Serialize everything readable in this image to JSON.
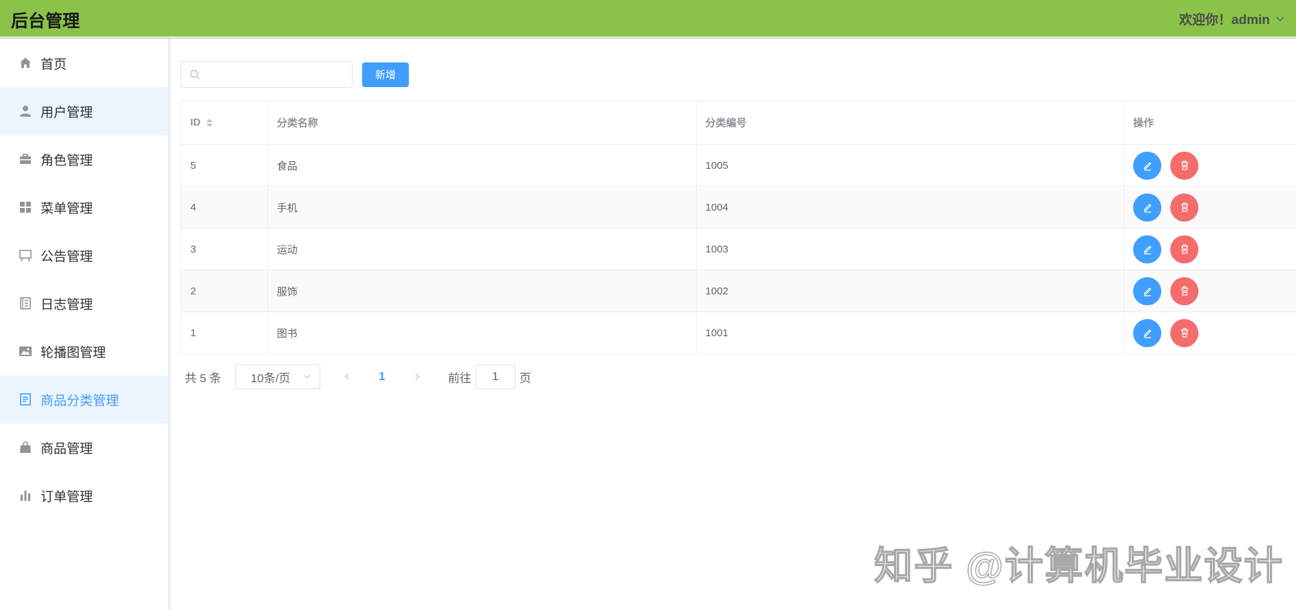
{
  "header": {
    "title": "后台管理",
    "welcome": "欢迎你！admin"
  },
  "sidebar": {
    "items": [
      {
        "label": "首页",
        "icon": "home-icon"
      },
      {
        "label": "用户管理",
        "icon": "user-icon"
      },
      {
        "label": "角色管理",
        "icon": "briefcase-icon"
      },
      {
        "label": "菜单管理",
        "icon": "grid-icon"
      },
      {
        "label": "公告管理",
        "icon": "board-icon"
      },
      {
        "label": "日志管理",
        "icon": "notebook-icon"
      },
      {
        "label": "轮播图管理",
        "icon": "picture-icon"
      },
      {
        "label": "商品分类管理",
        "icon": "document-icon"
      },
      {
        "label": "商品管理",
        "icon": "bag-icon"
      },
      {
        "label": "订单管理",
        "icon": "chart-icon"
      }
    ]
  },
  "toolbar": {
    "search_placeholder": "",
    "add_label": "新增"
  },
  "table": {
    "headers": {
      "id": "ID",
      "name": "分类名称",
      "code": "分类编号",
      "op": "操作"
    },
    "rows": [
      {
        "id": "5",
        "name": "食品",
        "code": "1005"
      },
      {
        "id": "4",
        "name": "手机",
        "code": "1004"
      },
      {
        "id": "3",
        "name": "运动",
        "code": "1003"
      },
      {
        "id": "2",
        "name": "服饰",
        "code": "1002"
      },
      {
        "id": "1",
        "name": "图书",
        "code": "1001"
      }
    ]
  },
  "pager": {
    "total": "共 5 条",
    "size": "10条/页",
    "current": "1",
    "goto": "前往",
    "jump_value": "1",
    "unit": "页"
  },
  "watermark": "知乎 @计算机毕业设计",
  "colors": {
    "header": "#8bc34a",
    "primary": "#409eff",
    "danger": "#f56c6c"
  }
}
